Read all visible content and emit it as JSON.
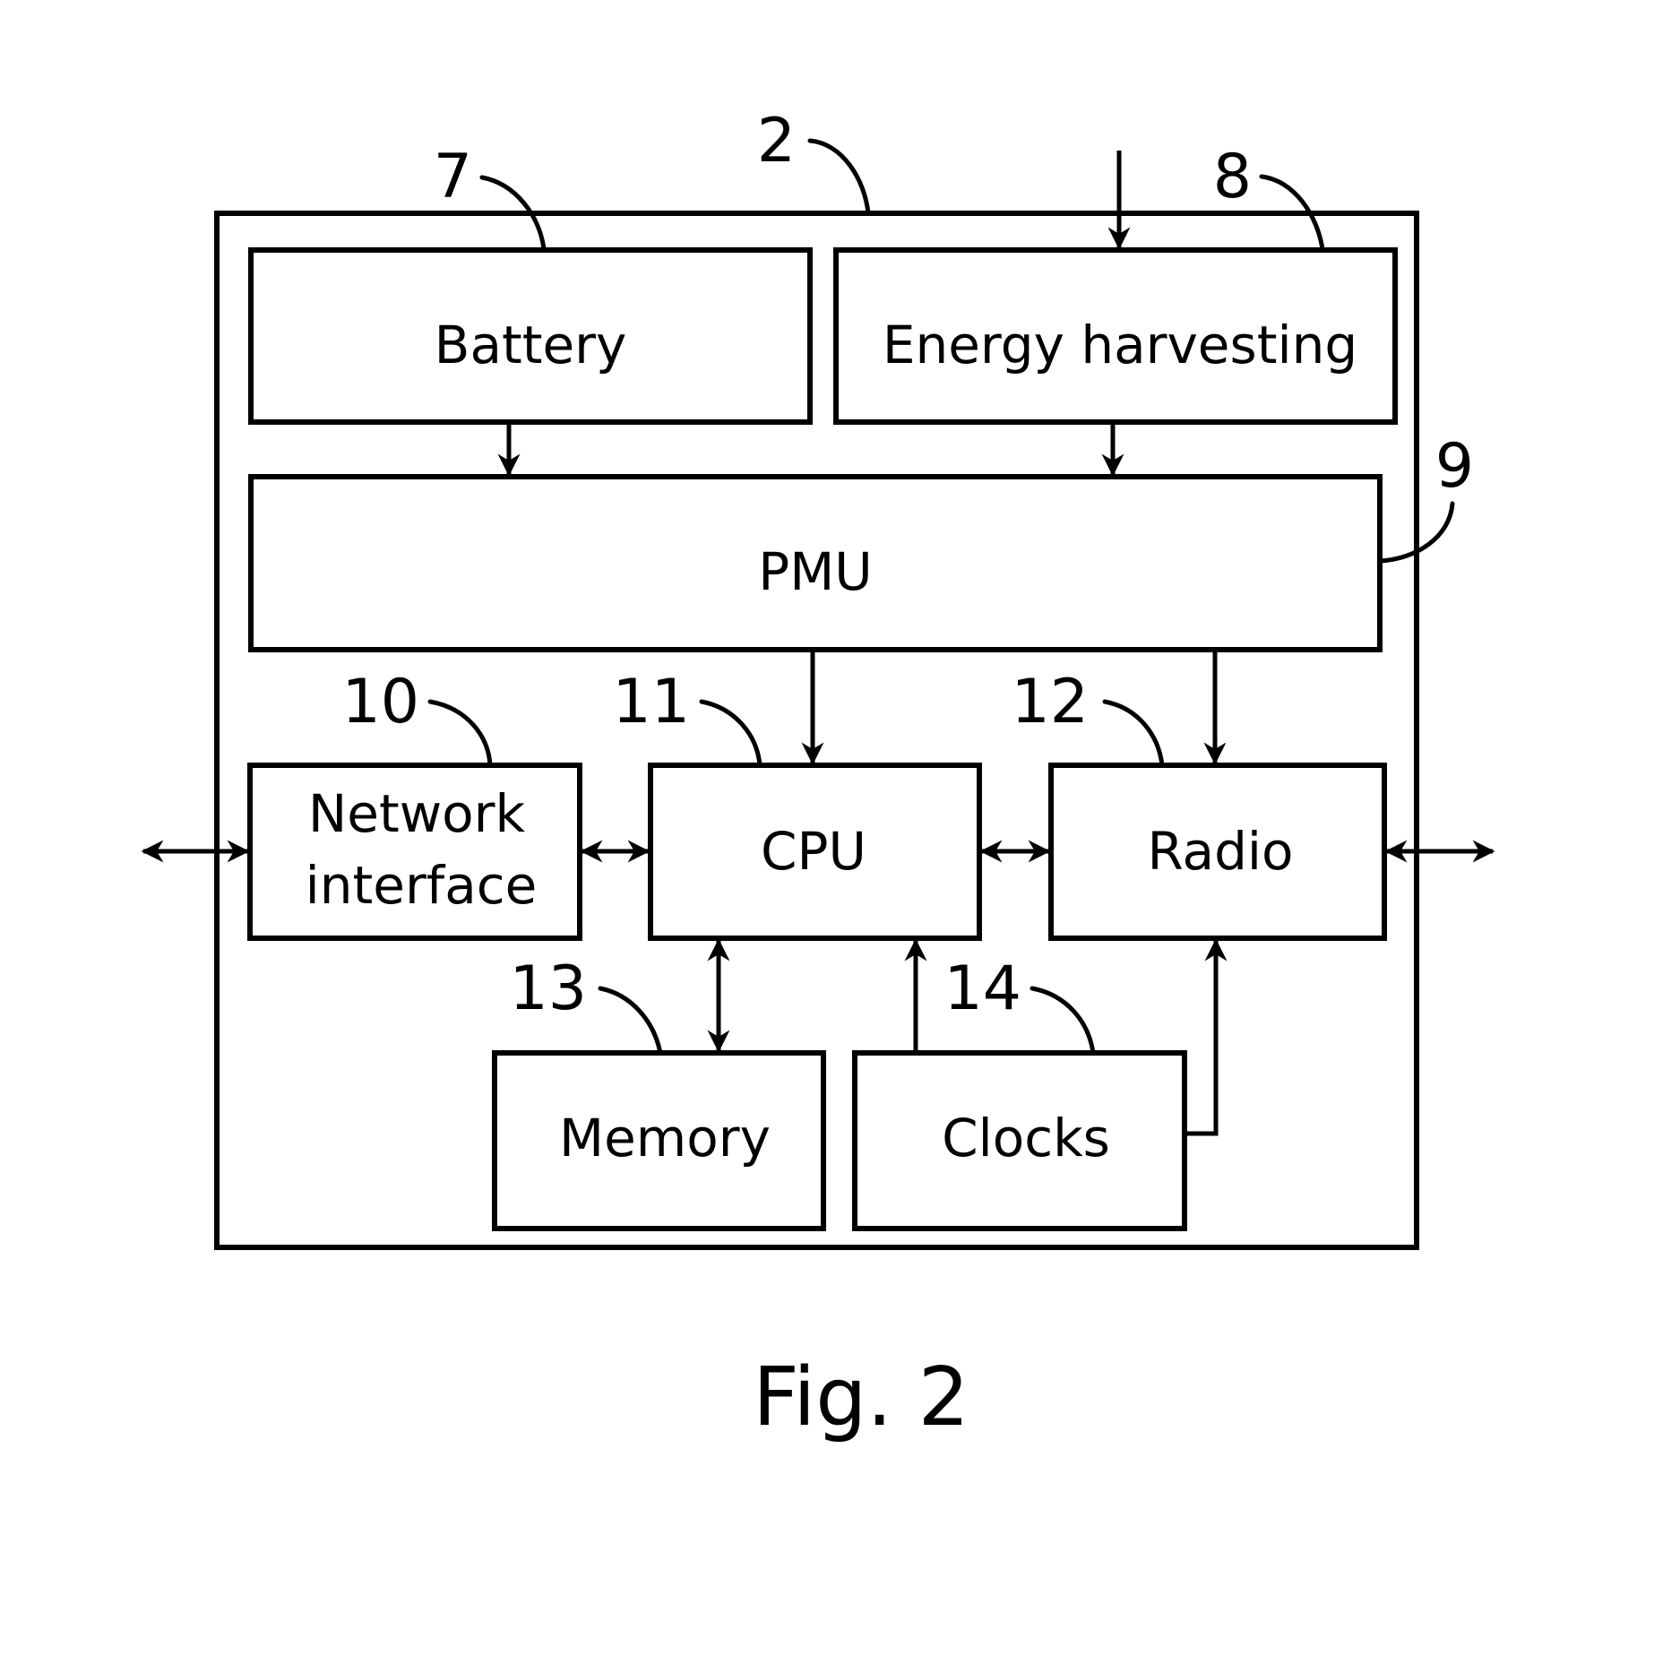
{
  "figure": {
    "caption": "Fig. 2",
    "device_ref": "2"
  },
  "blocks": {
    "battery": {
      "label": "Battery",
      "ref": "7"
    },
    "energy_harvesting": {
      "label": "Energy harvesting",
      "ref": "8"
    },
    "pmu": {
      "label": "PMU",
      "ref": "9"
    },
    "network_interface": {
      "label_line1": "Network",
      "label_line2": "interface",
      "ref": "10"
    },
    "cpu": {
      "label": "CPU",
      "ref": "11"
    },
    "radio": {
      "label": "Radio",
      "ref": "12"
    },
    "memory": {
      "label": "Memory",
      "ref": "13"
    },
    "clocks": {
      "label": "Clocks",
      "ref": "14"
    }
  },
  "connections": [
    {
      "from": "external",
      "to": "energy_harvesting",
      "direction": "one-way"
    },
    {
      "from": "battery",
      "to": "pmu",
      "direction": "one-way"
    },
    {
      "from": "energy_harvesting",
      "to": "pmu",
      "direction": "one-way"
    },
    {
      "from": "pmu",
      "to": "cpu",
      "direction": "one-way"
    },
    {
      "from": "pmu",
      "to": "radio",
      "direction": "one-way"
    },
    {
      "from": "external-left",
      "to": "network_interface",
      "direction": "two-way"
    },
    {
      "from": "network_interface",
      "to": "cpu",
      "direction": "two-way"
    },
    {
      "from": "cpu",
      "to": "radio",
      "direction": "two-way"
    },
    {
      "from": "radio",
      "to": "external-right",
      "direction": "two-way"
    },
    {
      "from": "memory",
      "to": "cpu",
      "direction": "two-way"
    },
    {
      "from": "clocks",
      "to": "cpu",
      "direction": "one-way"
    },
    {
      "from": "clocks",
      "to": "radio",
      "direction": "one-way"
    }
  ]
}
